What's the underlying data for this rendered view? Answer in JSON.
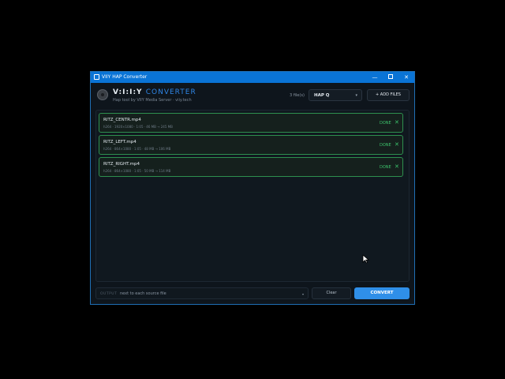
{
  "window": {
    "title": "VIIY HAP Converter",
    "minimize": "—",
    "close": "✕"
  },
  "header": {
    "brand_main": "V:I:I:Y",
    "brand_accent": "CONVERTER",
    "subtitle": "Hap tool by VIIY Media Server · viiy.tech",
    "file_count": "3 file(s)",
    "codec_select": {
      "value": "HAP Q",
      "caret": "▾"
    },
    "add_files": "+ ADD FILES"
  },
  "files": [
    {
      "name": "RITZ_CENTR.mp4",
      "meta": "h264 · 1920×1080 · 1:05 · 46 MB → 245 MB",
      "status": "DONE",
      "remove": "✕"
    },
    {
      "name": "RITZ_LEFT.mp4",
      "meta": "h264 · 864×1080 · 1:05 · 48 MB → 106 MB",
      "status": "DONE",
      "remove": "✕"
    },
    {
      "name": "RITZ_RIGHT.mp4",
      "meta": "h264 · 864×1080 · 1:05 · 50 MB → 114 MB",
      "status": "DONE",
      "remove": "✕"
    }
  ],
  "footer": {
    "output_label": "OUTPUT",
    "output_value": "next to each source file",
    "output_caret": "▾",
    "clear": "Clear",
    "convert": "CONVERT"
  },
  "colors": {
    "accent": "#2f8fe8",
    "done": "#3cc36b",
    "titlebar": "#0a74d6"
  }
}
